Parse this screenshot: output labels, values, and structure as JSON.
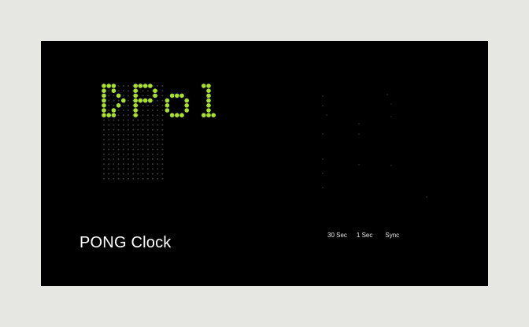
{
  "app": {
    "title": "PONG Clock"
  },
  "display": {
    "text": "Pol",
    "lit_color": "#a8e02a",
    "dim_color": "#3a3a3a"
  },
  "controls": {
    "buttons": [
      {
        "label": "30 Sec"
      },
      {
        "label": "1 Sec"
      },
      {
        "label": "Sync"
      }
    ]
  }
}
